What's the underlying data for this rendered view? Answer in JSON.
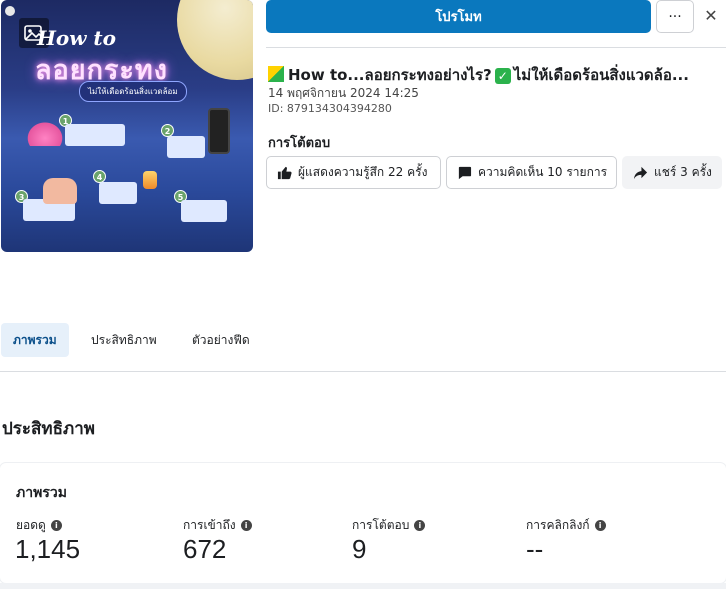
{
  "thumbnail": {
    "headline_en": "How to",
    "headline_th": "ลอยกระทง",
    "subtitle": "ไม่ให้เดือดร้อนสิ่งแวดล้อม",
    "steps": [
      "1",
      "2",
      "3",
      "4",
      "5"
    ]
  },
  "header": {
    "promote_label": "โปรโมท",
    "more_label": "···",
    "close_label": "✕"
  },
  "post": {
    "title": "How to...ลอยกระทงอย่างไร?",
    "title_suffix": "ไม่ให้เดือดร้อนสิ่งแวดล้อ...",
    "date": "14 พฤศจิกายน 2024 14:25",
    "id": "ID: 879134304394280"
  },
  "reactions": {
    "title": "การโต้ตอบ",
    "likes_label": "ผู้แสดงความรู้สึก 22 ครั้ง",
    "comments_label": "ความคิดเห็น 10 รายการ",
    "shares_label": "แชร์ 3 ครั้ง"
  },
  "tabs": [
    {
      "label": "ภาพรวม",
      "active": true
    },
    {
      "label": "ประสิทธิภาพ",
      "active": false
    },
    {
      "label": "ตัวอย่างฟีด",
      "active": false
    }
  ],
  "performance": {
    "section_title": "ประสิทธิภาพ",
    "overview_title": "ภาพรวม",
    "metrics": [
      {
        "label": "ยอดดู",
        "value": "1,145"
      },
      {
        "label": "การเข้าถึง",
        "value": "672"
      },
      {
        "label": "การโต้ตอบ",
        "value": "9"
      },
      {
        "label": "การคลิกลิงก์",
        "value": "--"
      }
    ]
  },
  "colors": {
    "primary": "#0a78be",
    "active_tab_bg": "#e6f0fa"
  }
}
